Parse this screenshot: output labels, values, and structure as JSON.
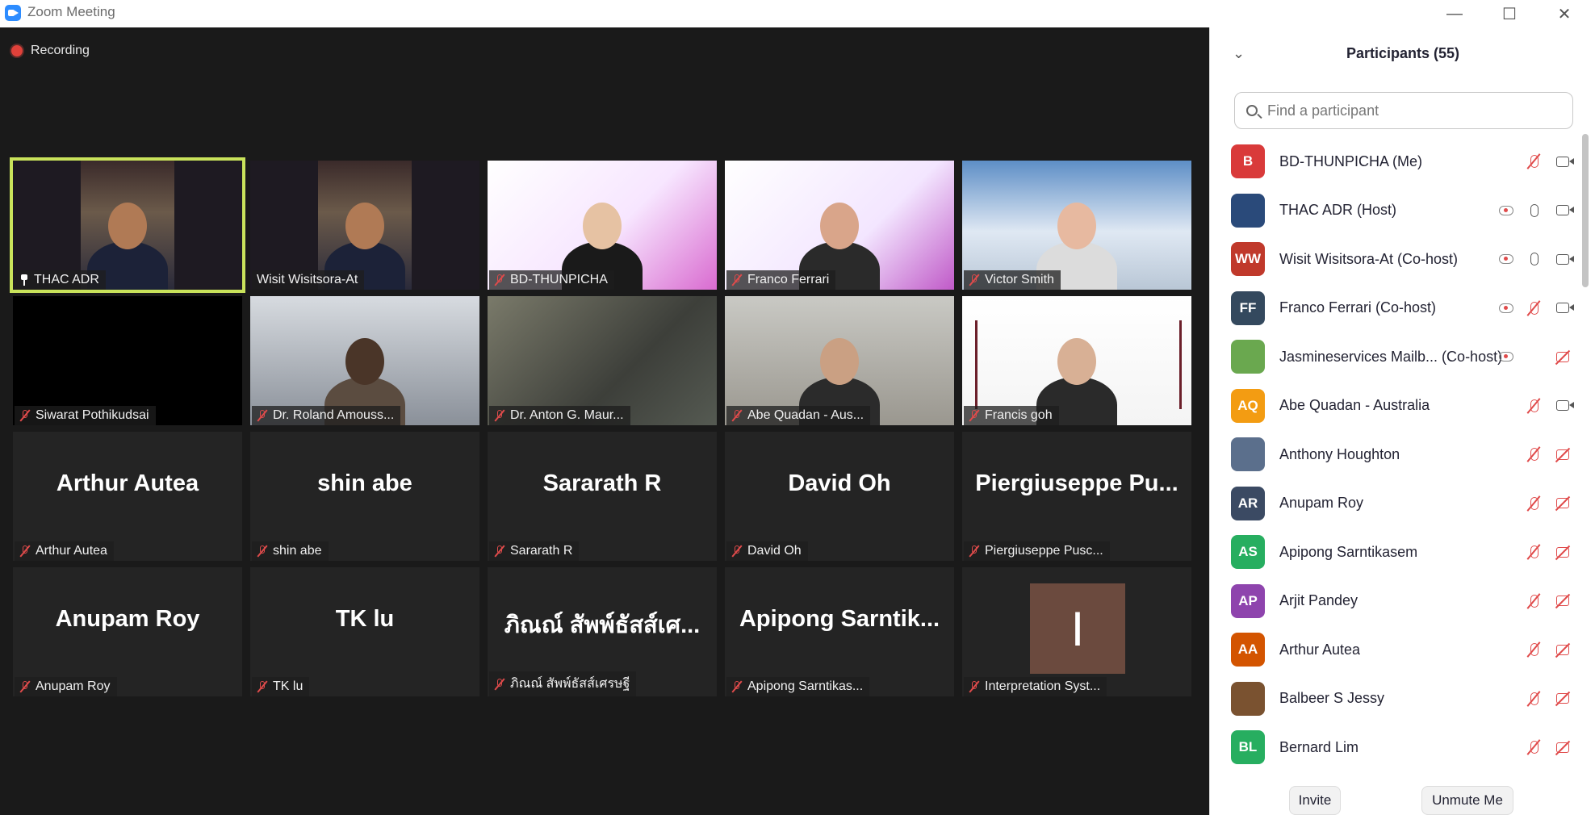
{
  "window": {
    "title": "Zoom Meeting"
  },
  "recording": {
    "label": "Recording"
  },
  "tiles": [
    {
      "name": "THAC ADR",
      "big": "",
      "icon": "pin",
      "video": true
    },
    {
      "name": "Wisit Wisitsora-At",
      "big": "",
      "icon": "none",
      "video": true
    },
    {
      "name": "BD-THUNPICHA",
      "big": "",
      "icon": "mic-off",
      "video": true
    },
    {
      "name": "Franco Ferrari",
      "big": "",
      "icon": "mic-off",
      "video": true
    },
    {
      "name": "Victor Smith",
      "big": "",
      "icon": "mic-off",
      "video": true
    },
    {
      "name": "Siwarat Pothikudsai",
      "big": "",
      "icon": "mic-off",
      "video": true
    },
    {
      "name": "Dr. Roland Amouss...",
      "big": "",
      "icon": "mic-off",
      "video": true
    },
    {
      "name": "Dr. Anton G. Maur...",
      "big": "",
      "icon": "mic-off",
      "video": true
    },
    {
      "name": "Abe Quadan - Aus...",
      "big": "",
      "icon": "mic-off",
      "video": true
    },
    {
      "name": "Francis goh",
      "big": "",
      "icon": "mic-off",
      "video": true
    },
    {
      "name": "Arthur Autea",
      "big": "Arthur Autea",
      "icon": "mic-off",
      "video": false
    },
    {
      "name": "shin abe",
      "big": "shin abe",
      "icon": "mic-off",
      "video": false
    },
    {
      "name": "Sararath R",
      "big": "Sararath R",
      "icon": "mic-off",
      "video": false
    },
    {
      "name": "David Oh",
      "big": "David Oh",
      "icon": "mic-off",
      "video": false
    },
    {
      "name": "Piergiuseppe Pusc...",
      "big": "Piergiuseppe  Pu...",
      "icon": "mic-off",
      "video": false
    },
    {
      "name": "Anupam Roy",
      "big": "Anupam Roy",
      "icon": "mic-off",
      "video": false
    },
    {
      "name": "TK lu",
      "big": "TK lu",
      "icon": "mic-off",
      "video": false
    },
    {
      "name": "ภิณณ์ สัพพ์ธัสส์เศรษฐี",
      "big": "ภิณณ์ สัพพ์ธัสส์เศ...",
      "icon": "mic-off",
      "video": false
    },
    {
      "name": "Apipong Sarntikas...",
      "big": "Apipong  Sarntik...",
      "icon": "mic-off",
      "video": false
    },
    {
      "name": "Interpretation Syst...",
      "big": "",
      "icon": "mic-off",
      "video": false,
      "avatar_letter": "I"
    }
  ],
  "panel": {
    "title": "Participants (55)",
    "search_placeholder": "Find a participant",
    "participants": [
      {
        "initials": "B",
        "name": "BD-THUNPICHA (Me)",
        "color": "#d93a3a",
        "rec": false,
        "mic": "off",
        "cam": "on"
      },
      {
        "initials": "",
        "name": "THAC ADR (Host)",
        "color": "#2a4a7a",
        "rec": true,
        "mic": "on",
        "cam": "on"
      },
      {
        "initials": "WW",
        "name": "Wisit Wisitsora-At (Co-host)",
        "color": "#c0392b",
        "rec": true,
        "mic": "on",
        "cam": "on"
      },
      {
        "initials": "FF",
        "name": "Franco Ferrari (Co-host)",
        "color": "#34495e",
        "rec": true,
        "mic": "off",
        "cam": "on"
      },
      {
        "initials": "",
        "name": "Jasmineservices Mailb...  (Co-host)",
        "color": "#6aa84f",
        "rec": true,
        "mic": "none",
        "cam": "off"
      },
      {
        "initials": "AQ",
        "name": "Abe Quadan - Australia",
        "color": "#f39c12",
        "rec": false,
        "mic": "off",
        "cam": "on"
      },
      {
        "initials": "",
        "name": "Anthony Houghton",
        "color": "#5b6f8c",
        "rec": false,
        "mic": "off",
        "cam": "off"
      },
      {
        "initials": "AR",
        "name": "Anupam Roy",
        "color": "#3b4a63",
        "rec": false,
        "mic": "off",
        "cam": "off"
      },
      {
        "initials": "AS",
        "name": "Apipong Sarntikasem",
        "color": "#27ae60",
        "rec": false,
        "mic": "off",
        "cam": "off"
      },
      {
        "initials": "AP",
        "name": "Arjit Pandey",
        "color": "#8e44ad",
        "rec": false,
        "mic": "off",
        "cam": "off"
      },
      {
        "initials": "AA",
        "name": "Arthur Autea",
        "color": "#d35400",
        "rec": false,
        "mic": "off",
        "cam": "off"
      },
      {
        "initials": "",
        "name": "Balbeer S Jessy",
        "color": "#7a5230",
        "rec": false,
        "mic": "off",
        "cam": "off"
      },
      {
        "initials": "BL",
        "name": "Bernard Lim",
        "color": "#27ae60",
        "rec": false,
        "mic": "off",
        "cam": "off"
      }
    ],
    "invite_label": "Invite",
    "unmute_label": "Unmute Me"
  }
}
